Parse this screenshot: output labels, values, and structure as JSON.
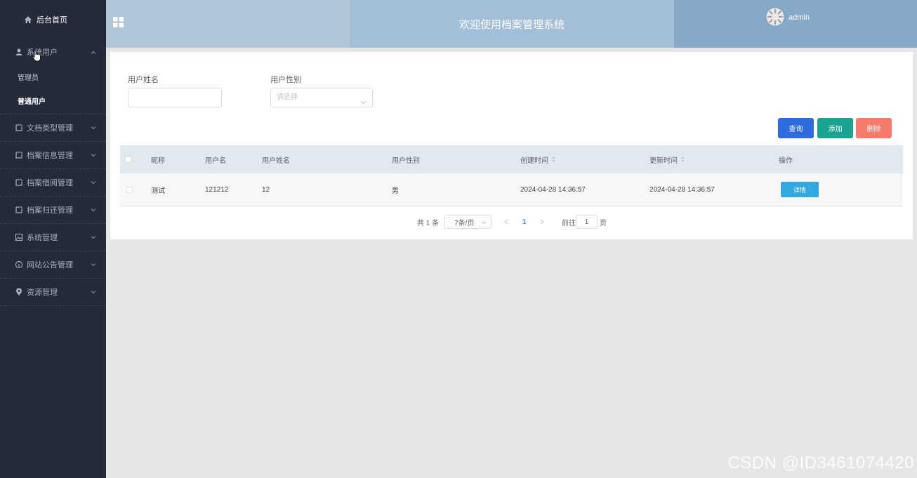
{
  "sidebar": {
    "home_label": "后台首页",
    "items": [
      {
        "label": "系统用户",
        "icon": "user-icon",
        "open": true,
        "children": [
          {
            "label": "管理员"
          },
          {
            "label": "普通用户"
          }
        ]
      },
      {
        "label": "文档类型管理",
        "icon": "document-icon"
      },
      {
        "label": "档案信息管理",
        "icon": "document-icon"
      },
      {
        "label": "档案借阅管理",
        "icon": "document-icon"
      },
      {
        "label": "档案归还管理",
        "icon": "document-icon"
      },
      {
        "label": "系统管理",
        "icon": "image-icon"
      },
      {
        "label": "网站公告管理",
        "icon": "info-icon"
      },
      {
        "label": "资源管理",
        "icon": "location-icon"
      }
    ]
  },
  "header": {
    "title": "欢迎使用档案管理系统",
    "username": "admin"
  },
  "filters": {
    "name_label": "用户姓名",
    "name_value": "",
    "gender_label": "用户性别",
    "gender_placeholder": "请选择"
  },
  "actions": {
    "query": "查询",
    "add": "添加",
    "delete": "删除"
  },
  "table": {
    "headers": {
      "nickname": "昵称",
      "username": "用户名",
      "realname": "用户姓名",
      "gender": "用户性别",
      "created": "创建时间",
      "updated": "更新时间",
      "ops": "操作"
    },
    "rows": [
      {
        "nickname": "测试",
        "username": "121212",
        "realname": "12",
        "gender": "男",
        "created": "2024-04-28 14:36:57",
        "updated": "2024-04-28 14:36:57",
        "detail": "详情"
      }
    ]
  },
  "pagination": {
    "total": "共 1 条",
    "page_size": "7条/页",
    "current_page": "1",
    "goto_prefix": "前往",
    "goto_value": "1",
    "goto_suffix": "页"
  },
  "watermark": "CSDN @ID3461074420",
  "colors": {
    "sidebar_bg": "#232a38",
    "query": "#2d6de0",
    "add": "#1aa390",
    "delete": "#f57b6b",
    "detail": "#32a8e0"
  }
}
